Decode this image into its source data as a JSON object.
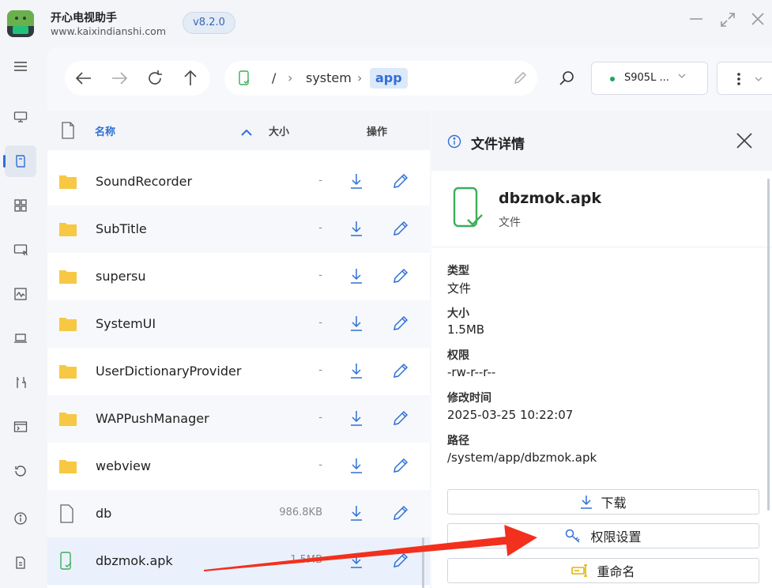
{
  "app": {
    "name": "开心电视助手",
    "url": "www.kaixindianshi.com",
    "version": "v8.2.0"
  },
  "toolbar": {
    "path_root": "/",
    "path_segments": [
      "system"
    ],
    "path_current": "app",
    "device_name": "S905L ...",
    "device_status_color": "#22a45d"
  },
  "list": {
    "col_name": "名称",
    "col_size": "大小",
    "col_ops": "操作",
    "rows": [
      {
        "name": "SoundRecorder",
        "size": "-",
        "type": "folder"
      },
      {
        "name": "SubTitle",
        "size": "-",
        "type": "folder"
      },
      {
        "name": "supersu",
        "size": "-",
        "type": "folder"
      },
      {
        "name": "SystemUI",
        "size": "-",
        "type": "folder"
      },
      {
        "name": "UserDictionaryProvider",
        "size": "-",
        "type": "folder"
      },
      {
        "name": "WAPPushManager",
        "size": "-",
        "type": "folder"
      },
      {
        "name": "webview",
        "size": "-",
        "type": "folder"
      },
      {
        "name": "db",
        "size": "986.8KB",
        "type": "file"
      },
      {
        "name": "dbzmok.apk",
        "size": "1.5MB",
        "type": "apk"
      }
    ]
  },
  "detail": {
    "title": "文件详情",
    "file_name": "dbzmok.apk",
    "file_kind": "文件",
    "type_label": "类型",
    "type_value": "文件",
    "size_label": "大小",
    "size_value": "1.5MB",
    "perm_label": "权限",
    "perm_value": "-rw-r--r--",
    "mtime_label": "修改时间",
    "mtime_value": "2025-03-25 10:22:07",
    "path_label": "路径",
    "path_value": "/system/app/dbzmok.apk",
    "btn_download": "下载",
    "btn_permissions": "权限设置",
    "btn_rename": "重命名"
  },
  "colors": {
    "accent": "#2f6fd6",
    "folder": "#f7c843",
    "apk": "#3cae5a",
    "annotation": "#f2301d"
  }
}
